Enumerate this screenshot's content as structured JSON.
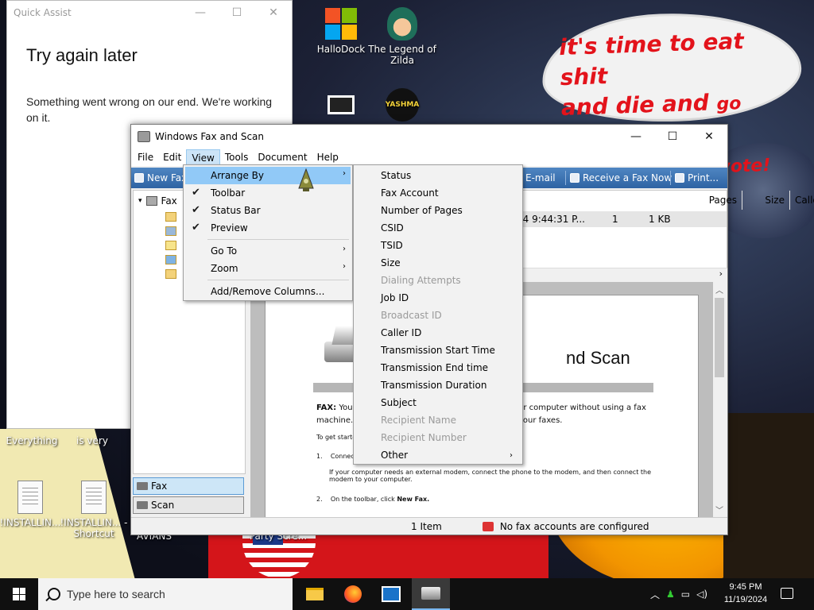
{
  "desktop": {
    "bubble": {
      "line1": "it's time to eat shit",
      "line2a": "and die and",
      "line2b": "go trick",
      "line3": "or treating and vote!"
    },
    "icons": [
      {
        "label": "HalloDock"
      },
      {
        "label": "The Legend of Zilda"
      },
      {
        "label": "YASHMA"
      },
      {
        "label": "Everything"
      },
      {
        "label": "is very"
      },
      {
        "label": "!INSTALLIN..."
      },
      {
        "label": "!INSTALLIN... - Shortcut"
      },
      {
        "label": "AVIANS"
      },
      {
        "label": "Party Scre..."
      }
    ]
  },
  "quick_assist": {
    "title": "Quick Assist",
    "heading": "Try again later",
    "message": "Something went wrong on our end. We're working on it."
  },
  "fax": {
    "title": "Windows Fax and Scan",
    "menu": [
      "File",
      "Edit",
      "View",
      "Tools",
      "Document",
      "Help"
    ],
    "toolbar": {
      "new_fax": "New Fax",
      "email": "E-mail",
      "receive": "Receive a Fax Now",
      "print": "Print..."
    },
    "tree": {
      "root": "Fax"
    },
    "nav": {
      "fax": "Fax",
      "scan": "Scan"
    },
    "list": {
      "headers": [
        "Pages",
        "Size",
        "Caller ID"
      ],
      "row": {
        "time": "24 9:44:31 P...",
        "pages": "1",
        "size": "1 KB"
      }
    },
    "preview": {
      "title": "nd Scan",
      "fax_label": "FAX:",
      "line1a": "You c",
      "line1b": "ur computer without using a fax",
      "line2a": "machine. V",
      "line2b": "your faxes.",
      "get_started": "To get started",
      "step1": "1.",
      "step1_text": "Connect",
      "modem_note": "If your computer needs an external modem, connect the phone to the modem, and then connect the modem to your computer.",
      "step2": "2.",
      "step2_text": "On the toolbar, click",
      "step2_bold": "New Fax."
    },
    "status": {
      "items": "1 Item",
      "accounts": "No fax accounts are configured"
    }
  },
  "view_menu": {
    "items": [
      {
        "label": "Arrange By",
        "arrow": "›"
      },
      {
        "label": "Toolbar",
        "check": "✔"
      },
      {
        "label": "Status Bar",
        "check": "✔"
      },
      {
        "label": "Preview",
        "check": "✔"
      },
      {
        "label": "Go To",
        "arrow": "›"
      },
      {
        "label": "Zoom",
        "arrow": "›"
      },
      {
        "label": "Add/Remove Columns..."
      }
    ]
  },
  "arrange_menu": {
    "items": [
      {
        "label": "Status"
      },
      {
        "label": "Fax Account"
      },
      {
        "label": "Number of Pages"
      },
      {
        "label": "CSID"
      },
      {
        "label": "TSID"
      },
      {
        "label": "Size"
      },
      {
        "label": "Dialing Attempts",
        "disabled": true
      },
      {
        "label": "Job ID"
      },
      {
        "label": "Broadcast ID",
        "disabled": true
      },
      {
        "label": "Caller ID"
      },
      {
        "label": "Transmission Start Time"
      },
      {
        "label": "Transmission End time"
      },
      {
        "label": "Transmission Duration"
      },
      {
        "label": "Subject"
      },
      {
        "label": "Recipient Name",
        "disabled": true
      },
      {
        "label": "Recipient Number",
        "disabled": true
      },
      {
        "label": "Other",
        "arrow": "›"
      }
    ]
  },
  "taskbar": {
    "search_placeholder": "Type here to search",
    "time": "9:45 PM",
    "date": "11/19/2024"
  },
  "colors": {
    "menu_highlight": "#91c9f7",
    "toolbar_blue": "#2e63a3",
    "bubble_red": "#e3131b"
  }
}
